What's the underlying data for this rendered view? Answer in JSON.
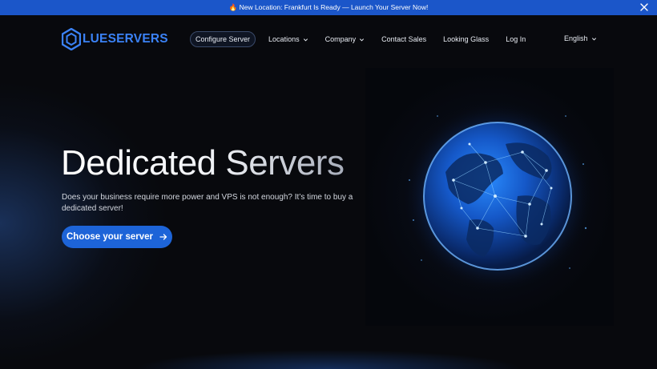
{
  "announcement": {
    "text": "🔥 New Location: Frankfurt Is Ready — Launch Your Server Now!"
  },
  "brand": {
    "name": "LUESERVERS",
    "accent": "#3b82f6"
  },
  "nav": {
    "items": [
      {
        "label": "Configure Server",
        "dropdown": false,
        "pill": true
      },
      {
        "label": "Locations",
        "dropdown": true
      },
      {
        "label": "Company",
        "dropdown": true
      },
      {
        "label": "Contact Sales",
        "dropdown": false
      },
      {
        "label": "Looking Glass",
        "dropdown": false
      },
      {
        "label": "Log In",
        "dropdown": false
      }
    ],
    "language": "English"
  },
  "hero": {
    "title": "Dedicated Servers",
    "description": "Does your business require more power and VPS is not enough? It’s time to buy a dedicated server!",
    "cta_label": "Choose your server",
    "cta_icon": "arrow-right-icon"
  },
  "colors": {
    "announce_bar": "#1b56c9",
    "cta": "#1d64d8",
    "background": "#08090d"
  }
}
